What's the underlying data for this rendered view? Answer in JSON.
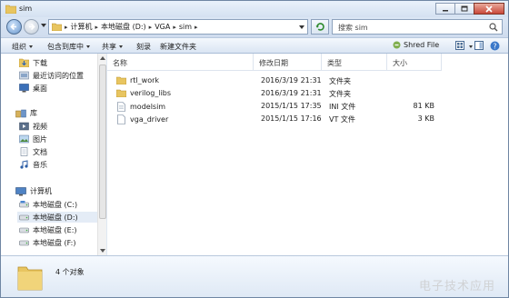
{
  "window": {
    "title": "sim"
  },
  "address": {
    "crumbs": [
      "计算机",
      "本地磁盘 (D:)",
      "VGA",
      "sim"
    ],
    "search_placeholder": "搜索 sim"
  },
  "toolbar": {
    "organize": "组织",
    "include_in_library": "包含到库中",
    "share": "共享",
    "burn": "刻录",
    "new_folder": "新建文件夹",
    "shred_file": "Shred File"
  },
  "nav": {
    "favorites": [
      "下载",
      "最近访问的位置",
      "桌面"
    ],
    "libraries_header": "库",
    "libraries": [
      "视频",
      "图片",
      "文档",
      "音乐"
    ],
    "computer_header": "计算机",
    "drives": [
      "本地磁盘 (C:)",
      "本地磁盘 (D:)",
      "本地磁盘 (E:)",
      "本地磁盘 (F:)"
    ],
    "selected": "本地磁盘 (D:)"
  },
  "columns": [
    "名称",
    "修改日期",
    "类型",
    "大小"
  ],
  "files": [
    {
      "name": "rtl_work",
      "modified": "2016/3/19 21:31",
      "type": "文件夹",
      "size": "",
      "icon": "folder-icon"
    },
    {
      "name": "verilog_libs",
      "modified": "2016/3/19 21:31",
      "type": "文件夹",
      "size": "",
      "icon": "folder-icon"
    },
    {
      "name": "modelsim",
      "modified": "2015/1/15 17:35",
      "type": "INI 文件",
      "size": "81 KB",
      "icon": "ini-file-icon"
    },
    {
      "name": "vga_driver",
      "modified": "2015/1/15 17:16",
      "type": "VT 文件",
      "size": "3 KB",
      "icon": "generic-file-icon"
    }
  ],
  "details": {
    "item_count": "4 个对象"
  },
  "watermark": "电子技术应用",
  "colors": {
    "window_frame": "#dfe8f3",
    "selection": "#e4ecf6",
    "folder": "#e8c560"
  }
}
